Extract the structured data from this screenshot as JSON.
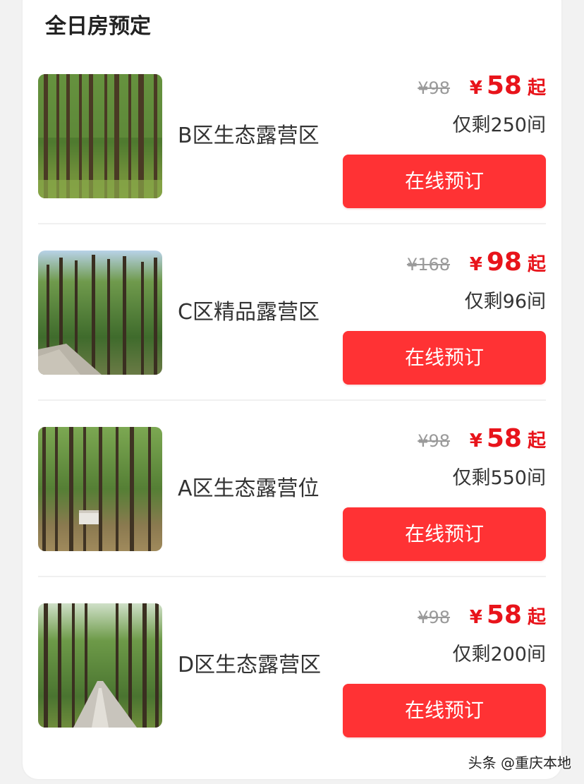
{
  "section": {
    "title": "全日房预定"
  },
  "listings": [
    {
      "name": "B区生态露营区",
      "original_price": "¥98",
      "currency": "¥",
      "price": "58",
      "price_suffix": "起",
      "stock": "仅剩250间",
      "book_label": "在线预订",
      "thumbnail": "forest-trees"
    },
    {
      "name": "C区精品露营区",
      "original_price": "¥168",
      "currency": "¥",
      "price": "98",
      "price_suffix": "起",
      "stock": "仅剩96间",
      "book_label": "在线预订",
      "thumbnail": "forest-path"
    },
    {
      "name": "A区生态露营位",
      "original_price": "¥98",
      "currency": "¥",
      "price": "58",
      "price_suffix": "起",
      "stock": "仅剩550间",
      "book_label": "在线预订",
      "thumbnail": "forest-campsite"
    },
    {
      "name": "D区生态露营区",
      "original_price": "¥98",
      "currency": "¥",
      "price": "58",
      "price_suffix": "起",
      "stock": "仅剩200间",
      "book_label": "在线预订",
      "thumbnail": "forest-road"
    }
  ],
  "colors": {
    "accent": "#ff3234",
    "price": "#e8141b",
    "strike": "#9a9a9a"
  },
  "watermark": "头条 @重庆本地"
}
